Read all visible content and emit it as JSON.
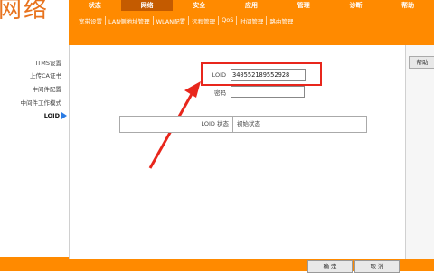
{
  "brand": {
    "text": "网络"
  },
  "main_nav": [
    {
      "label": "状态"
    },
    {
      "label": "网络",
      "active": true
    },
    {
      "label": "安全"
    },
    {
      "label": "应用"
    },
    {
      "label": "管理"
    },
    {
      "label": "诊断"
    },
    {
      "label": "帮助"
    }
  ],
  "sub_nav": [
    {
      "label": "宽带设置"
    },
    {
      "label": "LAN侧地址管理"
    },
    {
      "label": "WLAN配置"
    },
    {
      "label": "远程管理",
      "active": true
    },
    {
      "label": "QoS"
    },
    {
      "label": "时间管理"
    },
    {
      "label": "路由管理"
    }
  ],
  "sidebar": {
    "items": [
      {
        "label": "ITMS设置"
      },
      {
        "label": "上传CA证书"
      },
      {
        "label": "中间件配置"
      },
      {
        "label": "中间件工作模式"
      },
      {
        "label": "LOID",
        "active": true
      }
    ]
  },
  "form": {
    "loid_label": "LOID",
    "loid_value": "340552189552928",
    "password_label": "密码",
    "password_value": "",
    "status_label": "LOID 状态",
    "status_value": "初始状态"
  },
  "buttons": {
    "help": "帮助",
    "ok": "确 定",
    "cancel": "取 消"
  },
  "colors": {
    "accent": "#ff8a00",
    "accent_dark": "#c45b00",
    "highlight": "#e8261c",
    "nav_arrow": "#2a7be4"
  }
}
